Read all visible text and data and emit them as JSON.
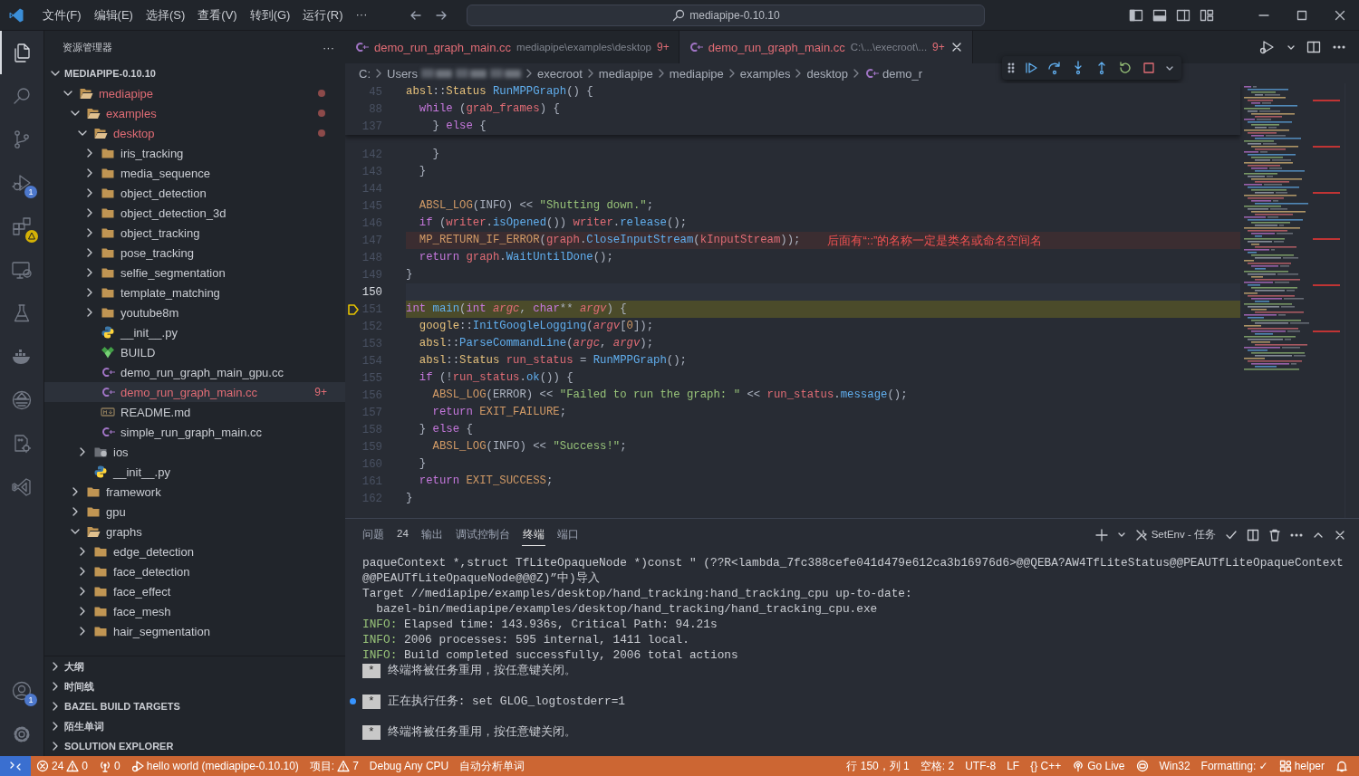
{
  "title_bar": {
    "menu": [
      "文件(F)",
      "编辑(E)",
      "选择(S)",
      "查看(V)",
      "转到(G)",
      "运行(R)",
      "···"
    ],
    "search": "mediapipe-0.10.10"
  },
  "activity_bar": {
    "top": [
      {
        "kind": "files",
        "selected": true
      },
      {
        "kind": "search",
        "selected": false
      },
      {
        "kind": "branch",
        "selected": false
      },
      {
        "kind": "debug",
        "selected": false,
        "badge": "1"
      },
      {
        "kind": "extensions",
        "selected": false,
        "warning": true
      },
      {
        "kind": "remote",
        "selected": false
      },
      {
        "kind": "flask",
        "selected": false
      },
      {
        "kind": "docker",
        "selected": false
      },
      {
        "kind": "hub",
        "selected": false
      },
      {
        "kind": "cmake",
        "selected": false
      },
      {
        "kind": "vs",
        "selected": false
      }
    ],
    "bottom": [
      {
        "kind": "account",
        "selected": false,
        "badge": "1"
      },
      {
        "kind": "gear",
        "selected": false
      }
    ]
  },
  "sidebar": {
    "title": "资源管理器",
    "more": "···",
    "root": {
      "label": "MEDIAPIPE-0.10.10",
      "expanded": true,
      "children": [
        {
          "label": "mediapipe",
          "kind": "folder",
          "expanded": true,
          "error": true,
          "selected": false,
          "children": [
            {
              "label": "examples",
              "kind": "folder",
              "expanded": true,
              "error": true,
              "selected": false,
              "children": [
                {
                  "label": "desktop",
                  "kind": "folder",
                  "expanded": true,
                  "error": true,
                  "selected": false,
                  "children": [
                    {
                      "label": "iris_tracking",
                      "kind": "folder",
                      "expanded": false,
                      "error": false,
                      "selected": false
                    },
                    {
                      "label": "media_sequence",
                      "kind": "folder",
                      "expanded": false,
                      "error": false,
                      "selected": false
                    },
                    {
                      "label": "object_detection",
                      "kind": "folder",
                      "expanded": false,
                      "error": false,
                      "selected": false
                    },
                    {
                      "label": "object_detection_3d",
                      "kind": "folder",
                      "expanded": false,
                      "error": false,
                      "selected": false
                    },
                    {
                      "label": "object_tracking",
                      "kind": "folder",
                      "expanded": false,
                      "error": false,
                      "selected": false
                    },
                    {
                      "label": "pose_tracking",
                      "kind": "folder",
                      "expanded": false,
                      "error": false,
                      "selected": false
                    },
                    {
                      "label": "selfie_segmentation",
                      "kind": "folder",
                      "expanded": false,
                      "error": false,
                      "selected": false
                    },
                    {
                      "label": "template_matching",
                      "kind": "folder",
                      "expanded": false,
                      "error": false,
                      "selected": false
                    },
                    {
                      "label": "youtube8m",
                      "kind": "folder",
                      "expanded": false,
                      "error": false,
                      "selected": false
                    },
                    {
                      "label": "__init__.py",
                      "kind": "python",
                      "error": false,
                      "selected": false
                    },
                    {
                      "label": "BUILD",
                      "kind": "bazel",
                      "error": false,
                      "selected": false
                    },
                    {
                      "label": "demo_run_graph_main_gpu.cc",
                      "kind": "cpp",
                      "error": false,
                      "selected": false
                    },
                    {
                      "label": "demo_run_graph_main.cc",
                      "kind": "cpp",
                      "error": true,
                      "selected": true,
                      "badge": "9+"
                    },
                    {
                      "label": "README.md",
                      "kind": "markdown",
                      "error": false,
                      "selected": false
                    },
                    {
                      "label": "simple_run_graph_main.cc",
                      "kind": "cpp",
                      "error": false,
                      "selected": false
                    }
                  ]
                },
                {
                  "label": "ios",
                  "kind": "apple-folder",
                  "expanded": false,
                  "error": false,
                  "selected": false
                },
                {
                  "label": "__init__.py",
                  "kind": "python",
                  "error": false,
                  "selected": false
                }
              ]
            },
            {
              "label": "framework",
              "kind": "folder",
              "expanded": false,
              "error": false,
              "selected": false
            },
            {
              "label": "gpu",
              "kind": "folder",
              "expanded": false,
              "error": false,
              "selected": false
            },
            {
              "label": "graphs",
              "kind": "folder",
              "expanded": true,
              "error": false,
              "selected": false,
              "children": [
                {
                  "label": "edge_detection",
                  "kind": "folder",
                  "expanded": false,
                  "error": false,
                  "selected": false
                },
                {
                  "label": "face_detection",
                  "kind": "folder",
                  "expanded": false,
                  "error": false,
                  "selected": false
                },
                {
                  "label": "face_effect",
                  "kind": "folder",
                  "expanded": false,
                  "error": false,
                  "selected": false
                },
                {
                  "label": "face_mesh",
                  "kind": "folder",
                  "expanded": false,
                  "error": false,
                  "selected": false
                },
                {
                  "label": "hair_segmentation",
                  "kind": "folder",
                  "expanded": false,
                  "error": false,
                  "selected": false
                }
              ]
            }
          ]
        }
      ]
    },
    "sections": [
      "大纲",
      "时间线",
      "BAZEL BUILD TARGETS",
      "陌生单词",
      "SOLUTION EXPLORER"
    ]
  },
  "editor": {
    "tabs": [
      {
        "label": "demo_run_graph_main.cc",
        "description": "mediapipe\\examples\\desktop",
        "badge": "9+",
        "error": true,
        "selected": false
      },
      {
        "label": "demo_run_graph_main.cc",
        "description": "C:\\...\\execroot\\...",
        "badge": "9+",
        "error": true,
        "selected": true
      }
    ],
    "breadcrumbs": [
      {
        "kind": "text",
        "text": "C:"
      },
      {
        "kind": "text",
        "text": "Users"
      },
      {
        "kind": "redacted"
      },
      {
        "kind": "redacted"
      },
      {
        "kind": "redacted"
      },
      {
        "kind": "text",
        "text": "execroot"
      },
      {
        "kind": "text",
        "text": "mediapipe"
      },
      {
        "kind": "text",
        "text": "mediapipe"
      },
      {
        "kind": "text",
        "text": "examples"
      },
      {
        "kind": "text",
        "text": "desktop"
      },
      {
        "kind": "cpp",
        "text": "demo_r"
      }
    ],
    "sticky_lines": [
      {
        "number": "45",
        "tokens": [
          {
            "text": "absl",
            "kind": "ns"
          },
          {
            "text": "::",
            "kind": "plain"
          },
          {
            "text": "Status ",
            "kind": "ns"
          },
          {
            "text": "RunMPPGraph",
            "kind": "fn"
          },
          {
            "text": "() {",
            "kind": "plain"
          }
        ]
      },
      {
        "number": "88",
        "tokens": [
          {
            "text": "  while",
            "kind": "kw"
          },
          {
            "text": " (",
            "kind": "plain"
          },
          {
            "text": "grab_frames",
            "kind": "var"
          },
          {
            "text": ") {",
            "kind": "plain"
          }
        ]
      },
      {
        "number": "137",
        "tokens": [
          {
            "text": "    } ",
            "kind": "plain"
          },
          {
            "text": "else",
            "kind": "kw"
          },
          {
            "text": " {",
            "kind": "plain"
          }
        ]
      }
    ],
    "lines": [
      {
        "number": "142",
        "kind": "normal",
        "tokens": [
          {
            "text": "    }",
            "kind": "plain"
          }
        ]
      },
      {
        "number": "143",
        "kind": "normal",
        "tokens": [
          {
            "text": "  }",
            "kind": "plain"
          }
        ]
      },
      {
        "number": "144",
        "kind": "normal"
      },
      {
        "number": "145",
        "kind": "normal",
        "tokens": [
          {
            "text": "  ABSL_LOG",
            "kind": "macro"
          },
          {
            "text": "(INFO) << ",
            "kind": "plain"
          },
          {
            "text": "\"Shutting down.\"",
            "kind": "str"
          },
          {
            "text": ";",
            "kind": "plain"
          }
        ]
      },
      {
        "number": "146",
        "kind": "normal",
        "tokens": [
          {
            "text": "  if",
            "kind": "kw"
          },
          {
            "text": " (",
            "kind": "plain"
          },
          {
            "text": "writer",
            "kind": "var"
          },
          {
            "text": ".",
            "kind": "plain"
          },
          {
            "text": "isOpened",
            "kind": "fn"
          },
          {
            "text": "()) ",
            "kind": "plain"
          },
          {
            "text": "writer",
            "kind": "var"
          },
          {
            "text": ".",
            "kind": "plain"
          },
          {
            "text": "release",
            "kind": "fn"
          },
          {
            "text": "();",
            "kind": "plain"
          }
        ]
      },
      {
        "number": "147",
        "kind": "error",
        "message": "后面有“::”的名称一定是类名或命名空间名",
        "tokens": [
          {
            "text": "  MP_RETURN_IF_ERROR",
            "kind": "error"
          },
          {
            "text": "(",
            "kind": "plain"
          },
          {
            "text": "graph",
            "kind": "var"
          },
          {
            "text": ".",
            "kind": "plain"
          },
          {
            "text": "CloseInputStream",
            "kind": "fn"
          },
          {
            "text": "(",
            "kind": "plain"
          },
          {
            "text": "kInputStream",
            "kind": "var"
          },
          {
            "text": "));",
            "kind": "plain"
          }
        ]
      },
      {
        "number": "148",
        "kind": "normal",
        "tokens": [
          {
            "text": "  return ",
            "kind": "kw"
          },
          {
            "text": "graph",
            "kind": "var"
          },
          {
            "text": ".",
            "kind": "plain"
          },
          {
            "text": "WaitUntilDone",
            "kind": "fn"
          },
          {
            "text": "();",
            "kind": "plain"
          }
        ]
      },
      {
        "number": "149",
        "kind": "normal",
        "tokens": [
          {
            "text": "}",
            "kind": "plain"
          }
        ]
      },
      {
        "number": "150",
        "kind": "cursor"
      },
      {
        "number": "151",
        "kind": "paused",
        "tokens": [
          {
            "text": "int ",
            "kind": "kw"
          },
          {
            "text": "main",
            "kind": "fn"
          },
          {
            "text": "(",
            "kind": "plain"
          },
          {
            "text": "int ",
            "kind": "kw"
          },
          {
            "text": "argc",
            "kind": "param"
          },
          {
            "text": ", ",
            "kind": "plain"
          },
          {
            "text": "char",
            "kind": "kw"
          },
          {
            "text": "** ",
            "kind": "plain"
          },
          {
            "text": "argv",
            "kind": "param"
          },
          {
            "text": ") {",
            "kind": "plain"
          }
        ]
      },
      {
        "number": "152",
        "kind": "normal",
        "tokens": [
          {
            "text": "  google",
            "kind": "ns"
          },
          {
            "text": "::",
            "kind": "plain"
          },
          {
            "text": "InitGoogleLogging",
            "kind": "fn"
          },
          {
            "text": "(",
            "kind": "plain"
          },
          {
            "text": "argv",
            "kind": "param"
          },
          {
            "text": "[",
            "kind": "plain"
          },
          {
            "text": "0",
            "kind": "num"
          },
          {
            "text": "]);",
            "kind": "plain"
          }
        ]
      },
      {
        "number": "153",
        "kind": "normal",
        "tokens": [
          {
            "text": "  absl",
            "kind": "ns"
          },
          {
            "text": "::",
            "kind": "plain"
          },
          {
            "text": "ParseCommandLine",
            "kind": "fn"
          },
          {
            "text": "(",
            "kind": "plain"
          },
          {
            "text": "argc",
            "kind": "param"
          },
          {
            "text": ", ",
            "kind": "plain"
          },
          {
            "text": "argv",
            "kind": "param"
          },
          {
            "text": ");",
            "kind": "plain"
          }
        ]
      },
      {
        "number": "154",
        "kind": "normal",
        "tokens": [
          {
            "text": "  absl",
            "kind": "ns"
          },
          {
            "text": "::",
            "kind": "plain"
          },
          {
            "text": "Status ",
            "kind": "ns"
          },
          {
            "text": "run_status",
            "kind": "var"
          },
          {
            "text": " = ",
            "kind": "plain"
          },
          {
            "text": "RunMPPGraph",
            "kind": "fn"
          },
          {
            "text": "();",
            "kind": "plain"
          }
        ]
      },
      {
        "number": "155",
        "kind": "normal",
        "tokens": [
          {
            "text": "  if",
            "kind": "kw"
          },
          {
            "text": " (!",
            "kind": "plain"
          },
          {
            "text": "run_status",
            "kind": "var"
          },
          {
            "text": ".",
            "kind": "plain"
          },
          {
            "text": "ok",
            "kind": "fn"
          },
          {
            "text": "()) {",
            "kind": "plain"
          }
        ]
      },
      {
        "number": "156",
        "kind": "normal",
        "tokens": [
          {
            "text": "    ABSL_LOG",
            "kind": "macro"
          },
          {
            "text": "(ERROR) << ",
            "kind": "plain"
          },
          {
            "text": "\"Failed to run the graph: \"",
            "kind": "str"
          },
          {
            "text": " << ",
            "kind": "plain"
          },
          {
            "text": "run_status",
            "kind": "var"
          },
          {
            "text": ".",
            "kind": "plain"
          },
          {
            "text": "message",
            "kind": "fn"
          },
          {
            "text": "();",
            "kind": "plain"
          }
        ]
      },
      {
        "number": "157",
        "kind": "normal",
        "tokens": [
          {
            "text": "    return ",
            "kind": "kw"
          },
          {
            "text": "EXIT_FAILURE",
            "kind": "macro"
          },
          {
            "text": ";",
            "kind": "plain"
          }
        ]
      },
      {
        "number": "158",
        "kind": "normal",
        "tokens": [
          {
            "text": "  } ",
            "kind": "plain"
          },
          {
            "text": "else",
            "kind": "kw"
          },
          {
            "text": " {",
            "kind": "plain"
          }
        ]
      },
      {
        "number": "159",
        "kind": "normal",
        "tokens": [
          {
            "text": "    ABSL_LOG",
            "kind": "macro"
          },
          {
            "text": "(INFO) << ",
            "kind": "plain"
          },
          {
            "text": "\"Success!\"",
            "kind": "str"
          },
          {
            "text": ";",
            "kind": "plain"
          }
        ]
      },
      {
        "number": "160",
        "kind": "normal",
        "tokens": [
          {
            "text": "  }",
            "kind": "plain"
          }
        ]
      },
      {
        "number": "161",
        "kind": "normal",
        "tokens": [
          {
            "text": "  return ",
            "kind": "kw"
          },
          {
            "text": "EXIT_SUCCESS",
            "kind": "macro"
          },
          {
            "text": ";",
            "kind": "plain"
          }
        ]
      },
      {
        "number": "162",
        "kind": "normal",
        "tokens": [
          {
            "text": "}",
            "kind": "plain"
          }
        ]
      }
    ]
  },
  "panel": {
    "tabs": [
      {
        "label": "问题",
        "badge": "24",
        "selected": false
      },
      {
        "label": "输出",
        "selected": false
      },
      {
        "label": "调试控制台",
        "selected": false
      },
      {
        "label": "终端",
        "selected": true
      },
      {
        "label": "端口",
        "selected": false
      }
    ],
    "task": "SetEnv - 任务",
    "terminal": [
      {
        "kind": "text",
        "text": "paqueContext *,struct TfLiteOpaqueNode *)const \" (??R<lambda_7fc388cefe041d479e612ca3b16976d6>@@QEBA?AW4TfLiteStatus@@PEAUTfLiteOpaqueContext"
      },
      {
        "kind": "text",
        "text": "@@PEAUTfLiteOpaqueNode@@@Z)”中)导入"
      },
      {
        "kind": "text",
        "text": "Target //mediapipe/examples/desktop/hand_tracking:hand_tracking_cpu up-to-date:"
      },
      {
        "kind": "text",
        "text": "  bazel-bin/mediapipe/examples/desktop/hand_tracking/hand_tracking_cpu.exe"
      },
      {
        "kind": "info",
        "label": "INFO:",
        "text": " Elapsed time: 143.936s, Critical Path: 94.21s"
      },
      {
        "kind": "info",
        "label": "INFO:",
        "text": " 2006 processes: 595 internal, 1411 local."
      },
      {
        "kind": "info",
        "label": "INFO:",
        "text": " Build completed successfully, 2006 total actions"
      },
      {
        "kind": "task",
        "badge": "*",
        "text": "终端将被任务重用，按任意键关闭。",
        "running": false
      },
      {
        "kind": "task",
        "badge": "*",
        "text": "正在执行任务: set GLOG_logtostderr=1",
        "running": true
      },
      {
        "kind": "task",
        "badge": "*",
        "text": "终端将被任务重用，按任意键关闭。",
        "running": false
      }
    ]
  },
  "status_bar": {
    "left": [
      {
        "kind": "remote"
      },
      {
        "kind": "problems",
        "errors": "24",
        "warnings": "0"
      },
      {
        "kind": "ports",
        "text": "0"
      },
      {
        "kind": "debug",
        "text": "hello world (mediapipe-0.10.10)"
      },
      {
        "kind": "warning",
        "label": "项目:",
        "text": "7"
      },
      {
        "kind": "text",
        "text": "Debug Any CPU"
      },
      {
        "kind": "text",
        "text": "自动分析单词"
      }
    ],
    "right": [
      {
        "kind": "text",
        "text": "行 150，列 1"
      },
      {
        "kind": "text",
        "text": "空格: 2"
      },
      {
        "kind": "text",
        "text": "UTF-8"
      },
      {
        "kind": "text",
        "text": "LF"
      },
      {
        "kind": "text",
        "text": "{} C++"
      },
      {
        "kind": "broadcast",
        "text": "Go Live"
      },
      {
        "kind": "copilot"
      },
      {
        "kind": "text",
        "text": "Win32"
      },
      {
        "kind": "text",
        "text": "Formatting: ✓"
      },
      {
        "kind": "account",
        "text": "helper"
      },
      {
        "kind": "bell"
      }
    ]
  }
}
